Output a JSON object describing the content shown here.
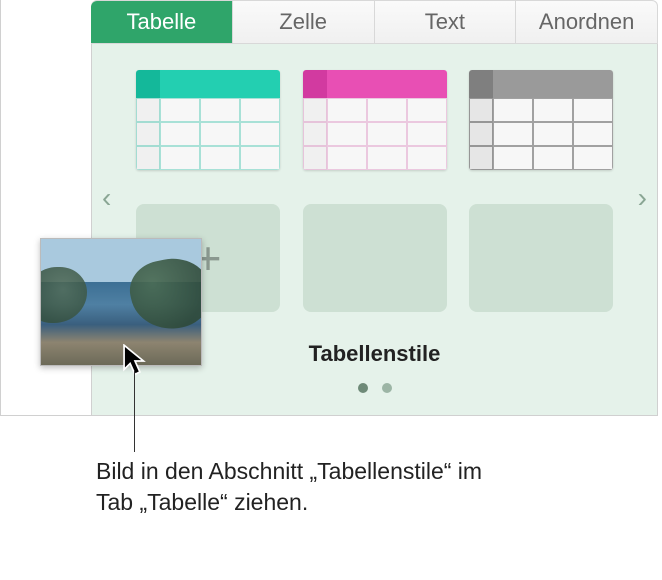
{
  "tabs": {
    "items": [
      {
        "label": "Tabelle",
        "active": true
      },
      {
        "label": "Zelle",
        "active": false
      },
      {
        "label": "Text",
        "active": false
      },
      {
        "label": "Anordnen",
        "active": false
      }
    ]
  },
  "styles_panel": {
    "title": "Tabellenstile",
    "nav_prev_glyph": "‹",
    "nav_next_glyph": "›",
    "add_glyph": "+",
    "page_count": 2,
    "active_page_index": 0,
    "styles": [
      {
        "name": "teal-header-style",
        "accent": "#23cfb1"
      },
      {
        "name": "pink-header-style",
        "accent": "#e84fb4"
      },
      {
        "name": "gray-header-style",
        "accent": "#9a9a9a"
      }
    ]
  },
  "drag": {
    "description": "coastal-landscape-thumbnail"
  },
  "callout": {
    "text": "Bild in den Abschnitt „Tabellenstile“ im Tab „Tabelle“ ziehen."
  }
}
